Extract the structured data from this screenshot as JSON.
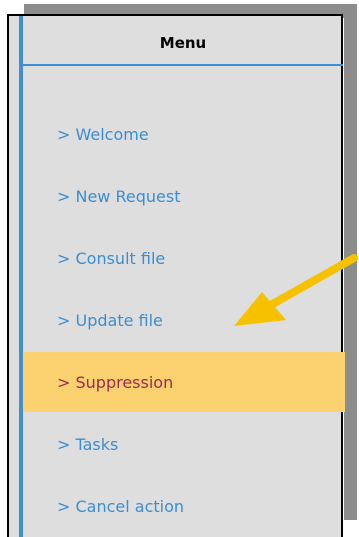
{
  "menu": {
    "title": "Menu",
    "items": [
      {
        "label": "> Welcome"
      },
      {
        "label": "> New Request"
      },
      {
        "label": "> Consult file"
      },
      {
        "label": "> Update file"
      },
      {
        "label": "> Suppression"
      },
      {
        "label": "> Tasks"
      },
      {
        "label": "> Cancel action"
      }
    ],
    "active_index": 4
  },
  "colors": {
    "panel_bg": "#dedede",
    "accent_blue": "#3f8fd2",
    "link_blue": "#3c8ed0",
    "highlight": "#fbd26f",
    "active_text": "#a0294c",
    "arrow": "#f6c200",
    "shadow": "#8c8c8c"
  },
  "annotation": {
    "icon": "arrow-pointer-icon"
  }
}
